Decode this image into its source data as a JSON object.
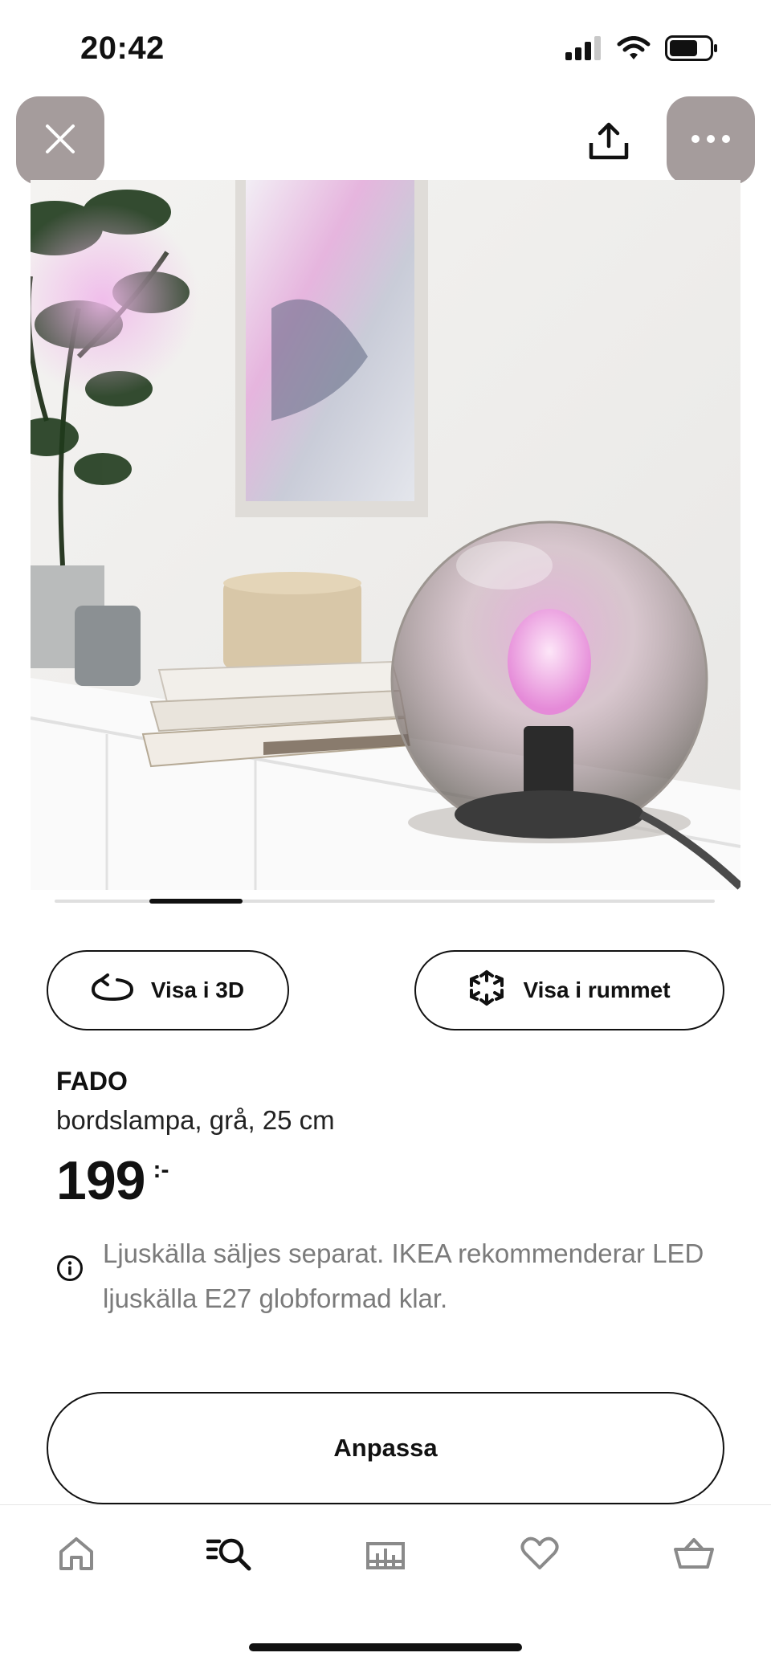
{
  "status_bar": {
    "time": "20:42",
    "icons": [
      "signal-icon",
      "wifi-icon",
      "battery-icon"
    ]
  },
  "top_bar": {
    "icons": [
      "close-icon",
      "share-icon",
      "more-icon"
    ]
  },
  "gallery": {
    "image": "product-photo-fado-lamp",
    "slide": 2,
    "slide_count": 7
  },
  "actions": {
    "view_3d_label": "Visa i 3D",
    "view_room_label": "Visa i rummet"
  },
  "product": {
    "name": "FADO",
    "description": "bordslampa, grå, 25 cm",
    "price": "199",
    "price_suffix": ":-",
    "notice": "Ljuskälla säljes separat. IKEA rekommenderar LED ljuskälla E27 globformad klar."
  },
  "customize_label": "Anpassa",
  "bottom_nav": {
    "items": [
      "home-icon",
      "search-icon",
      "rooms-icon",
      "favorites-icon",
      "cart-icon"
    ],
    "active": "search-icon"
  },
  "colors": {
    "button_overlay": "#a59c9c",
    "text": "#111111",
    "muted_text": "#7b7b7b"
  }
}
